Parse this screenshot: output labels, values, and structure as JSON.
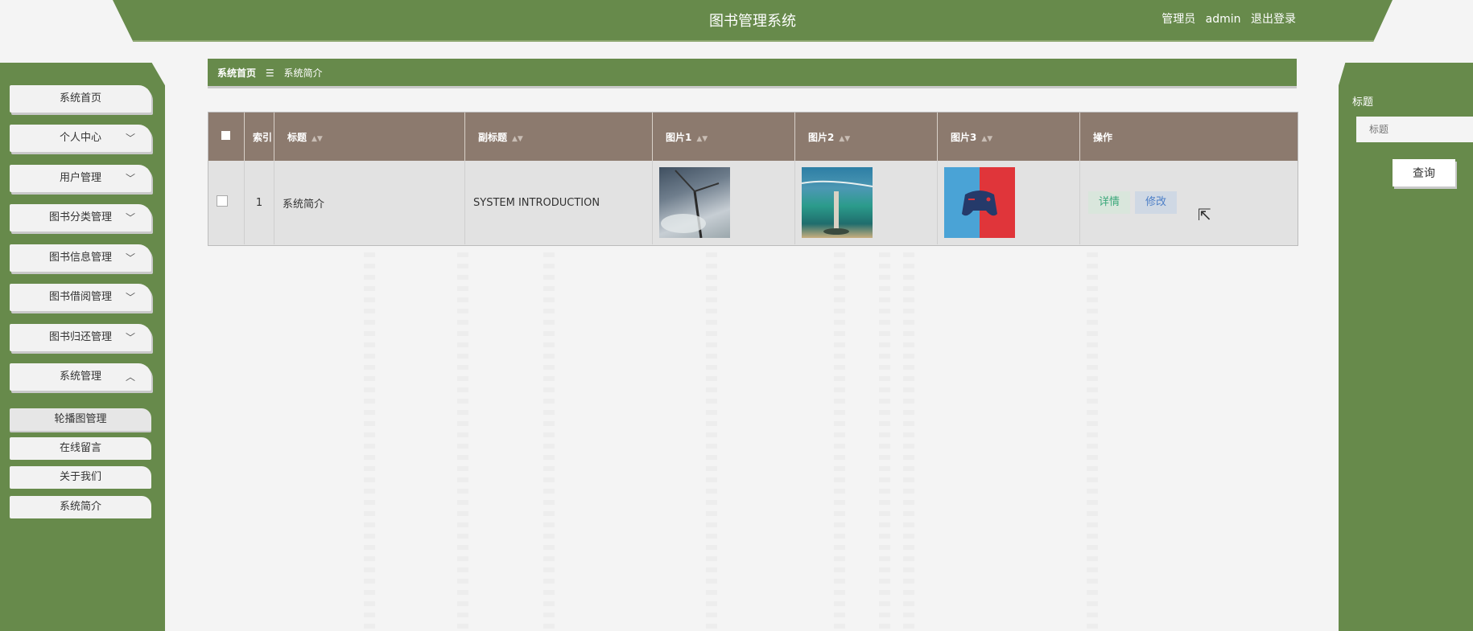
{
  "header": {
    "title": "图书管理系统",
    "role": "管理员",
    "username": "admin",
    "logout": "退出登录"
  },
  "sidebar": {
    "items": [
      {
        "label": "系统首页"
      },
      {
        "label": "个人中心"
      },
      {
        "label": "用户管理"
      },
      {
        "label": "图书分类管理"
      },
      {
        "label": "图书信息管理"
      },
      {
        "label": "图书借阅管理"
      },
      {
        "label": "图书归还管理"
      },
      {
        "label": "系统管理"
      }
    ],
    "subitems": [
      {
        "label": "轮播图管理"
      },
      {
        "label": "在线留言"
      },
      {
        "label": "关于我们"
      },
      {
        "label": "系统简介"
      }
    ]
  },
  "breadcrumb": {
    "home": "系统首页",
    "separator": "☰",
    "current": "系统简介"
  },
  "table": {
    "columns": [
      "索引",
      "标题",
      "副标题",
      "图片1",
      "图片2",
      "图片3",
      "操作"
    ],
    "rows": [
      {
        "index": "1",
        "title": "系统简介",
        "subtitle": "SYSTEM INTRODUCTION",
        "detail_label": "详情",
        "edit_label": "修改"
      }
    ]
  },
  "search": {
    "label": "标题",
    "placeholder": "标题",
    "button": "查询"
  },
  "colors": {
    "primary_green": "#678a4b",
    "table_header": "#8c7a6e"
  }
}
